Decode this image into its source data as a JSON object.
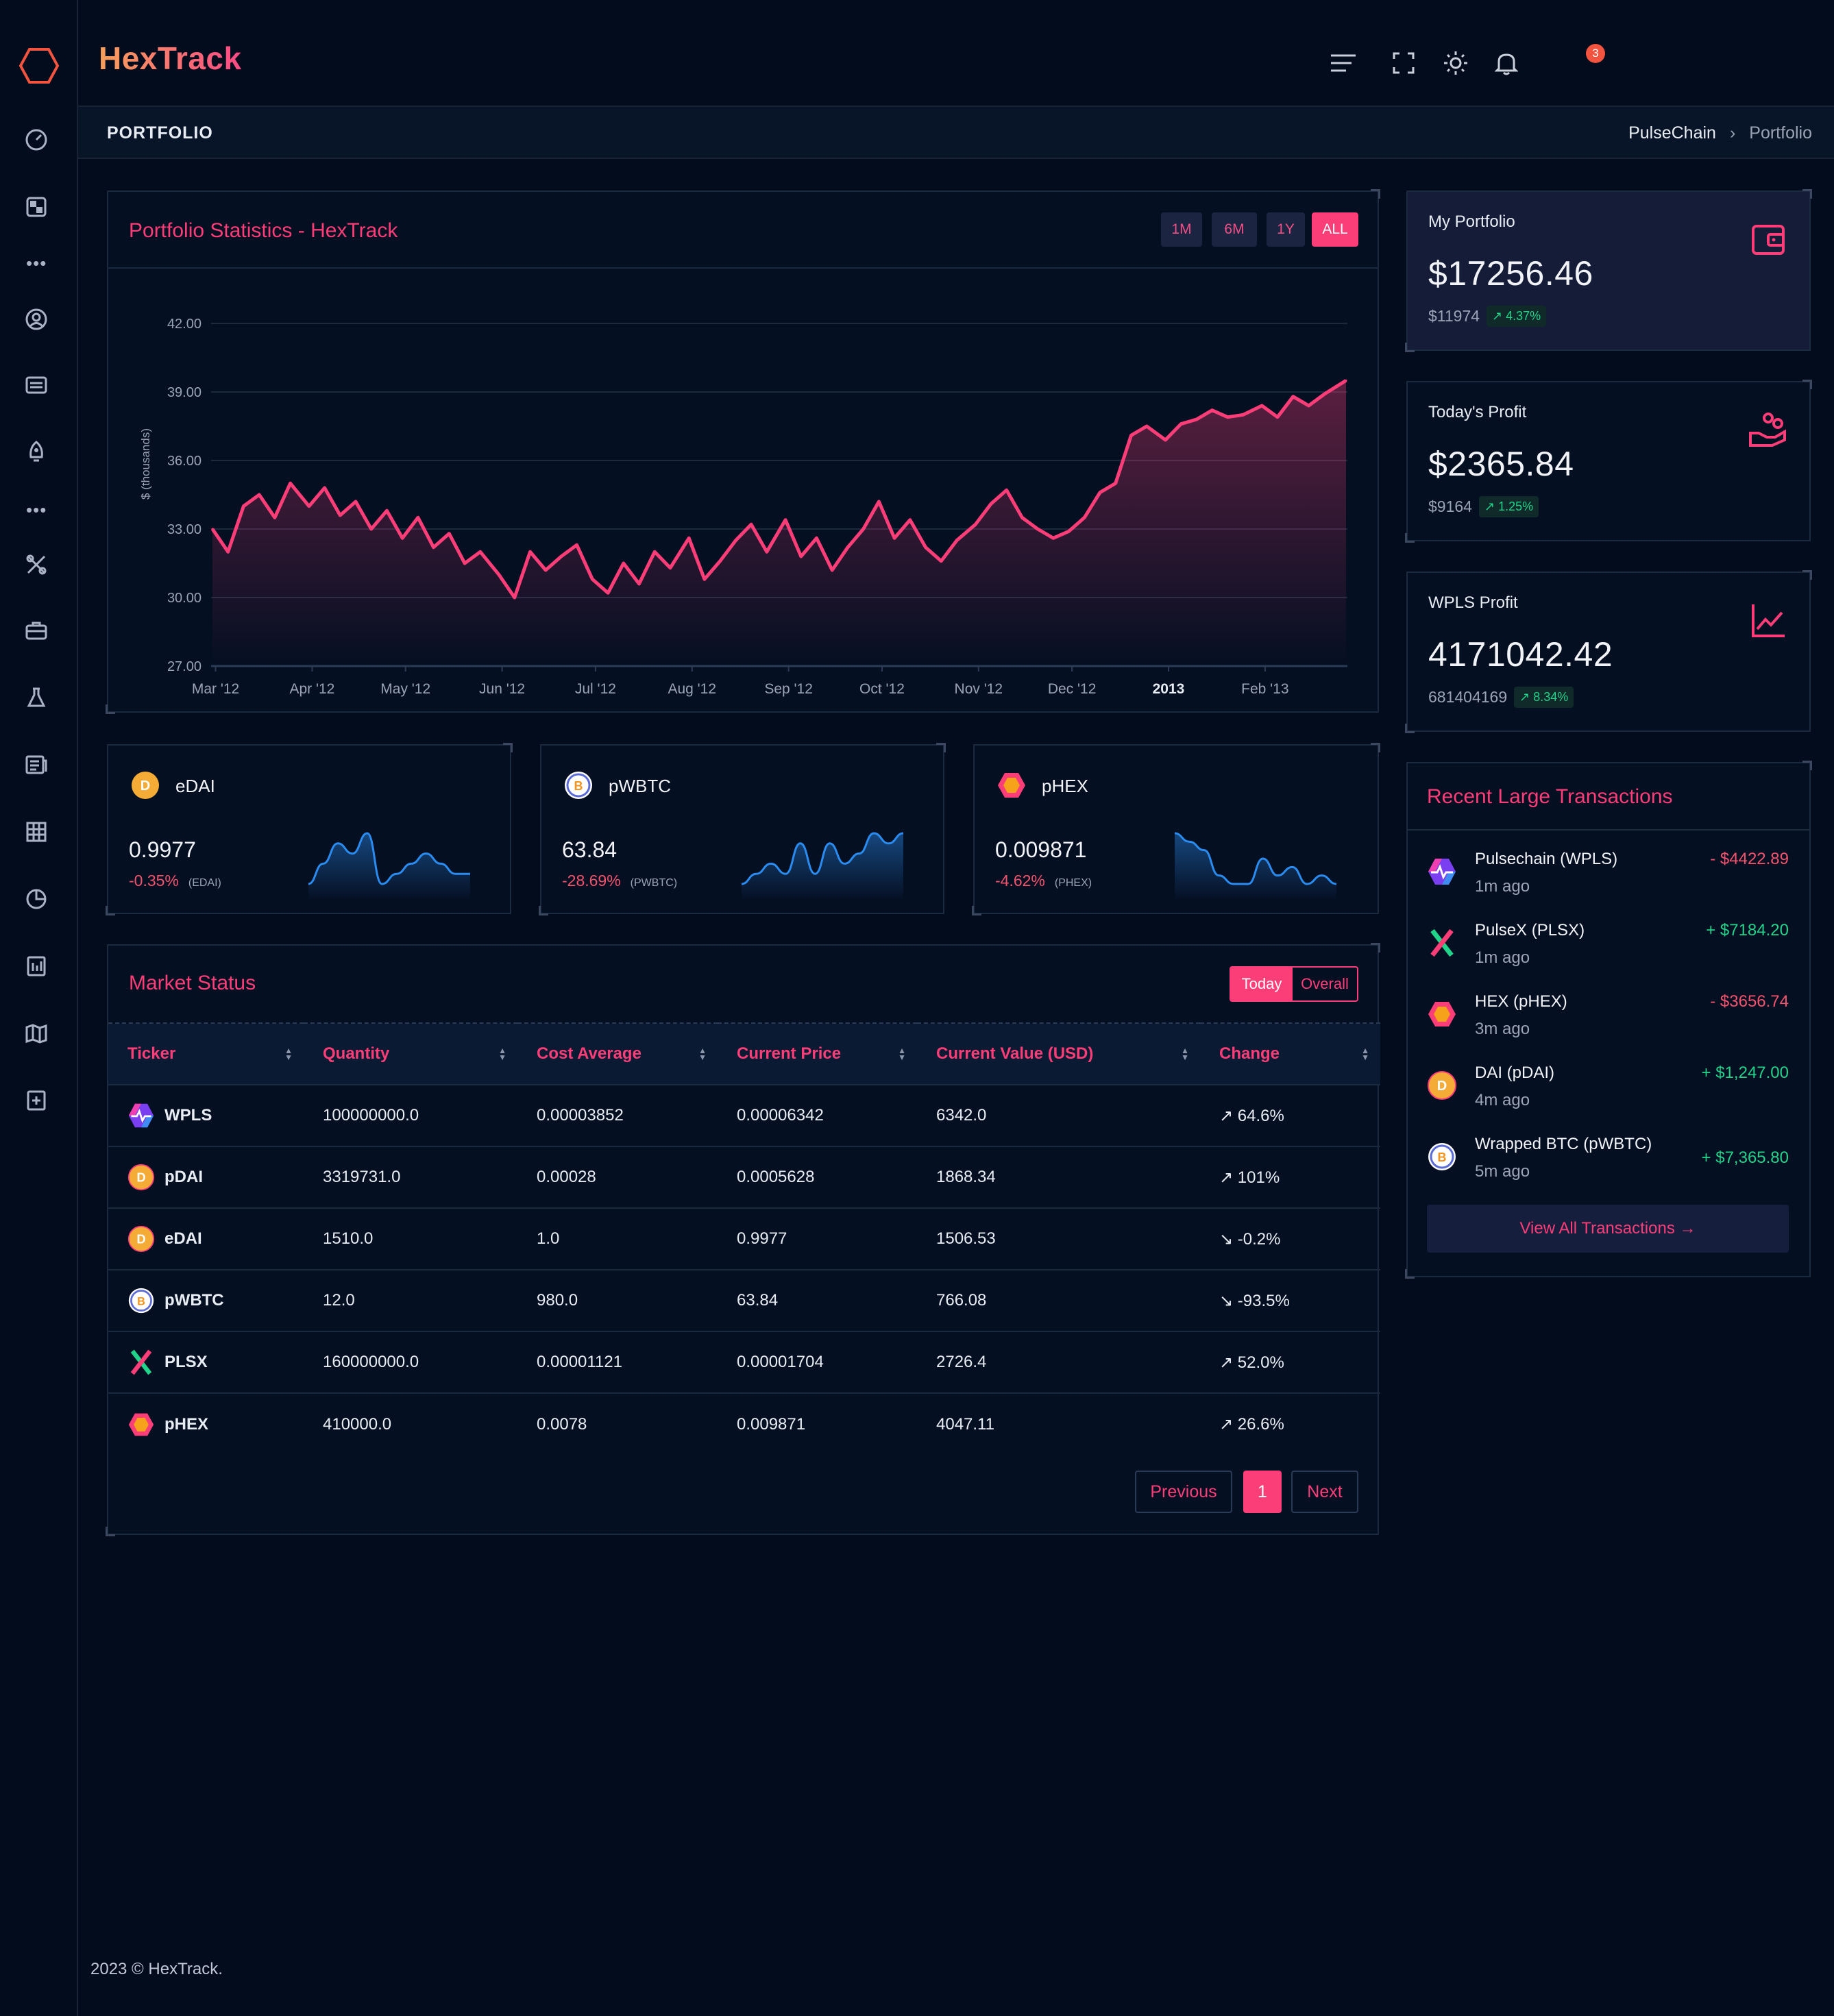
{
  "app": {
    "brand": "HexTrack",
    "notifications": "3",
    "footer": "2023 © HexTrack."
  },
  "colors": {
    "accent": "#fb3d78",
    "bg": "#030c1c",
    "up": "#22d38a",
    "down": "#f4536d",
    "line": "#fb3d78",
    "spark": "#2a8cf0"
  },
  "sidebar": {
    "icons": [
      "hexagon-logo-icon",
      "dashboard-gauge-icon",
      "widgets-icon",
      "user-circle-icon",
      "card-icon",
      "rocket-icon",
      "tools-icon",
      "briefcase-icon",
      "flask-icon",
      "newspaper-icon",
      "grid-icon",
      "pie-icon",
      "report-icon",
      "map-icon",
      "file-plus-icon"
    ]
  },
  "topbar": {
    "icons": [
      "menu-icon",
      "fullscreen-icon",
      "sun-icon",
      "bell-icon"
    ]
  },
  "pagebar": {
    "title": "PORTFOLIO",
    "crumb1": "PulseChain",
    "crumb_sep": "›",
    "crumb2": "Portfolio"
  },
  "chart_card": {
    "title": "Portfolio Statistics - HexTrack",
    "ranges": [
      "1M",
      "6M",
      "1Y",
      "ALL"
    ],
    "active": "ALL"
  },
  "chart_data": {
    "type": "area",
    "ylabel": "$ (thousands)",
    "xlabel": "",
    "ylim": [
      27,
      42
    ],
    "yticks": [
      "42.00",
      "39.00",
      "36.00",
      "33.00",
      "30.00",
      "27.00"
    ],
    "xticks": [
      "Mar '12",
      "Apr '12",
      "May '12",
      "Jun '12",
      "Jul '12",
      "Aug '12",
      "Sep '12",
      "Oct '12",
      "Nov '12",
      "Dec '12",
      "2013",
      "Feb '13"
    ],
    "x": [
      "2012-02-29",
      "2012-03-05",
      "2012-03-10",
      "2012-03-15",
      "2012-03-20",
      "2012-03-25",
      "2012-03-31",
      "2012-04-05",
      "2012-04-10",
      "2012-04-15",
      "2012-04-20",
      "2012-04-25",
      "2012-04-30",
      "2012-05-05",
      "2012-05-10",
      "2012-05-15",
      "2012-05-20",
      "2012-05-25",
      "2012-05-31",
      "2012-06-05",
      "2012-06-10",
      "2012-06-15",
      "2012-06-20",
      "2012-06-25",
      "2012-06-30",
      "2012-07-05",
      "2012-07-10",
      "2012-07-15",
      "2012-07-20",
      "2012-07-25",
      "2012-07-31",
      "2012-08-05",
      "2012-08-10",
      "2012-08-15",
      "2012-08-20",
      "2012-08-25",
      "2012-08-31",
      "2012-09-05",
      "2012-09-10",
      "2012-09-15",
      "2012-09-20",
      "2012-09-25",
      "2012-09-30",
      "2012-10-05",
      "2012-10-10",
      "2012-10-15",
      "2012-10-20",
      "2012-10-25",
      "2012-10-31",
      "2012-11-05",
      "2012-11-10",
      "2012-11-15",
      "2012-11-20",
      "2012-11-25",
      "2012-11-30",
      "2012-12-05",
      "2012-12-10",
      "2012-12-15",
      "2012-12-20",
      "2012-12-25",
      "2012-12-31",
      "2013-01-05",
      "2013-01-10",
      "2013-01-15",
      "2013-01-20",
      "2013-01-25",
      "2013-01-31",
      "2013-02-05",
      "2013-02-10",
      "2013-02-15",
      "2013-02-20",
      "2013-02-27"
    ],
    "values": [
      33.0,
      32.0,
      34.0,
      34.5,
      33.5,
      35.0,
      34.0,
      34.8,
      33.6,
      34.2,
      33.0,
      33.8,
      32.6,
      33.5,
      32.2,
      32.8,
      31.5,
      32.0,
      31.0,
      30.0,
      32.0,
      31.2,
      31.8,
      32.3,
      30.8,
      30.2,
      31.5,
      30.6,
      32.0,
      31.3,
      32.6,
      30.8,
      31.6,
      32.5,
      33.2,
      32.0,
      33.4,
      31.8,
      32.6,
      31.2,
      32.2,
      33.0,
      34.2,
      32.6,
      33.4,
      32.2,
      31.6,
      32.5,
      33.2,
      34.1,
      34.7,
      33.5,
      33.0,
      32.6,
      32.9,
      33.5,
      34.6,
      35.0,
      37.1,
      37.5,
      36.9,
      37.6,
      37.8,
      38.2,
      37.9,
      38.0,
      38.4,
      37.9,
      38.8,
      38.4,
      38.9,
      39.5
    ],
    "fill": "gradient"
  },
  "stats": [
    {
      "label": "My Portfolio",
      "value": "$17256.46",
      "sub": "$11974",
      "pct": "4.37%",
      "icon": "wallet-icon"
    },
    {
      "label": "Today's Profit",
      "value": "$2365.84",
      "sub": "$9164",
      "pct": "1.25%",
      "icon": "hand-coins-icon"
    },
    {
      "label": "WPLS Profit",
      "value": "4171042.42",
      "sub": "681404169",
      "pct": "8.34%",
      "icon": "chart-line-icon"
    }
  ],
  "tokens": [
    {
      "name": "eDAI",
      "price": "0.9977",
      "change": "-0.35%",
      "tag": "(EDAI)",
      "spark": [
        3,
        5,
        7,
        6,
        8,
        3,
        4,
        5,
        6,
        5,
        4,
        4
      ],
      "logo": "dai"
    },
    {
      "name": "pWBTC",
      "price": "63.84",
      "change": "-28.69%",
      "tag": "(PWBTC)",
      "spark": [
        2,
        3,
        4,
        3,
        6,
        3,
        6,
        4,
        5,
        7,
        6,
        7
      ],
      "logo": "btc"
    },
    {
      "name": "pHEX",
      "price": "0.009871",
      "change": "-4.62%",
      "tag": "(PHEX)",
      "spark": [
        8,
        7,
        6,
        3,
        2,
        2,
        5,
        3,
        4,
        2,
        3,
        2
      ],
      "logo": "hex"
    }
  ],
  "market": {
    "title": "Market Status",
    "toggle": [
      "Today",
      "Overall"
    ],
    "columns": [
      "Ticker",
      "Quantity",
      "Cost Average",
      "Current Price",
      "Current Value (USD)",
      "Change"
    ],
    "rows": [
      {
        "logo": "pls",
        "ticker": "WPLS",
        "qty": "100000000.0",
        "cost": "0.00003852",
        "price": "0.00006342",
        "value": "6342.0",
        "change": "64.6%",
        "dir": "up"
      },
      {
        "logo": "dai",
        "ticker": "pDAI",
        "qty": "3319731.0",
        "cost": "0.00028",
        "price": "0.0005628",
        "value": "1868.34",
        "change": "101%",
        "dir": "up"
      },
      {
        "logo": "dai",
        "ticker": "eDAI",
        "qty": "1510.0",
        "cost": "1.0",
        "price": "0.9977",
        "value": "1506.53",
        "change": "-0.2%",
        "dir": "down"
      },
      {
        "logo": "btc",
        "ticker": "pWBTC",
        "qty": "12.0",
        "cost": "980.0",
        "price": "63.84",
        "value": "766.08",
        "change": "-93.5%",
        "dir": "down"
      },
      {
        "logo": "plsx",
        "ticker": "PLSX",
        "qty": "160000000.0",
        "cost": "0.00001121",
        "price": "0.00001704",
        "value": "2726.4",
        "change": "52.0%",
        "dir": "up"
      },
      {
        "logo": "hex",
        "ticker": "pHEX",
        "qty": "410000.0",
        "cost": "0.0078",
        "price": "0.009871",
        "value": "4047.11",
        "change": "26.6%",
        "dir": "up"
      }
    ],
    "pager": {
      "prev": "Previous",
      "page": "1",
      "next": "Next"
    }
  },
  "transactions": {
    "title": "Recent Large Transactions",
    "items": [
      {
        "logo": "pls",
        "name": "Pulsechain (WPLS)",
        "time": "1m ago",
        "amount": "- $4422.89",
        "dir": "neg"
      },
      {
        "logo": "plsx",
        "name": "PulseX (PLSX)",
        "time": "1m ago",
        "amount": "+ $7184.20",
        "dir": "pos"
      },
      {
        "logo": "hex",
        "name": "HEX (pHEX)",
        "time": "3m ago",
        "amount": "- $3656.74",
        "dir": "neg"
      },
      {
        "logo": "dai",
        "name": "DAI (pDAI)",
        "time": "4m ago",
        "amount": "+ $1,247.00",
        "dir": "pos"
      },
      {
        "logo": "btc",
        "name": "Wrapped BTC (pWBTC)",
        "time": "5m ago",
        "amount": "+ $7,365.80",
        "dir": "pos"
      }
    ],
    "view_all": "View All Transactions →"
  }
}
